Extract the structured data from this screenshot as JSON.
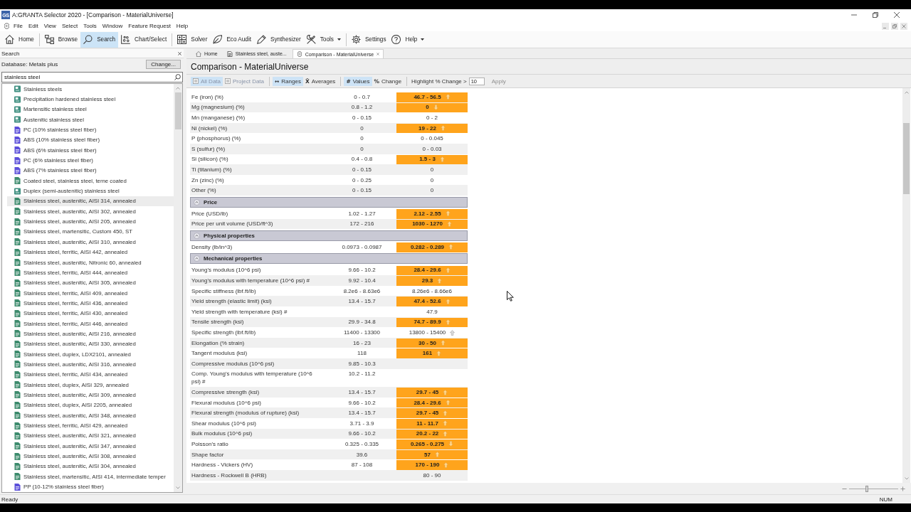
{
  "window": {
    "icon_label": "GS",
    "title": "A:GRANTA Selector 2020 - [Comparison - MaterialUniverse]"
  },
  "menu_bar": [
    "File",
    "Edit",
    "View",
    "Select",
    "Tools",
    "Window",
    "Feature Request",
    "Help"
  ],
  "toolbar": [
    [
      {
        "label": "Home",
        "kind": "home",
        "selected": false,
        "dropdown": false
      }
    ],
    [
      {
        "label": "Browse",
        "kind": "browse",
        "selected": false,
        "dropdown": false
      },
      {
        "label": "Search",
        "kind": "search",
        "selected": true,
        "dropdown": false
      },
      {
        "label": "Chart/Select",
        "kind": "chart",
        "selected": false,
        "dropdown": false
      }
    ],
    [
      {
        "label": "Solver",
        "kind": "solver",
        "selected": false,
        "dropdown": false
      },
      {
        "label": "Eco Audit",
        "kind": "eco",
        "selected": false,
        "dropdown": false
      },
      {
        "label": "Synthesizer",
        "kind": "synthesizer",
        "selected": false,
        "dropdown": false
      },
      {
        "label": "Tools",
        "kind": "tools",
        "selected": false,
        "dropdown": true
      }
    ],
    [
      {
        "label": "Settings",
        "kind": "settings",
        "selected": false,
        "dropdown": false
      },
      {
        "label": "Help",
        "kind": "help",
        "selected": false,
        "dropdown": true
      }
    ]
  ],
  "search_panel": {
    "title": "Search",
    "database": "Database: Metals plus",
    "change_button": "Change...",
    "query": "stainless steel",
    "results": [
      {
        "label": "Stainless steels",
        "kind": "group",
        "selected": false
      },
      {
        "label": "Precipitation hardened stainless steel",
        "kind": "group",
        "selected": false
      },
      {
        "label": "Martensitic stainless steel",
        "kind": "group",
        "selected": false
      },
      {
        "label": "Austenitic stainless steel",
        "kind": "group",
        "selected": false
      },
      {
        "label": "PC (10% stainless steel fiber)",
        "kind": "polymer",
        "selected": false
      },
      {
        "label": "ABS (10% stainless steel fiber)",
        "kind": "polymer",
        "selected": false
      },
      {
        "label": "ABS (6% stainless steel fiber)",
        "kind": "polymer",
        "selected": false
      },
      {
        "label": "PC (6% stainless steel fiber)",
        "kind": "polymer",
        "selected": false
      },
      {
        "label": "ABS (7% stainless steel fiber)",
        "kind": "polymer",
        "selected": false
      },
      {
        "label": "Coated steel, stainless steel, terne coated",
        "kind": "metal",
        "selected": false
      },
      {
        "label": "Duplex (semi-austenitic) stainless steel",
        "kind": "group",
        "selected": false
      },
      {
        "label": "Stainless steel, austenitic, AISI 314, annealed",
        "kind": "metal",
        "selected": true
      },
      {
        "label": "Stainless steel, austenitic, AISI 302, annealed",
        "kind": "metal",
        "selected": false
      },
      {
        "label": "Stainless steel, austenitic, AISI 205, annealed",
        "kind": "metal",
        "selected": false
      },
      {
        "label": "Stainless steel, martensitic, Custom 450, ST",
        "kind": "metal",
        "selected": false
      },
      {
        "label": "Stainless steel, austenitic, AISI 310, annealed",
        "kind": "metal",
        "selected": false
      },
      {
        "label": "Stainless steel, ferritic, AISI 442, annealed",
        "kind": "metal",
        "selected": false
      },
      {
        "label": "Stainless steel, austenitic, Nitronic 60, annealed",
        "kind": "metal",
        "selected": false
      },
      {
        "label": "Stainless steel, ferritic, AISI 444, annealed",
        "kind": "metal",
        "selected": false
      },
      {
        "label": "Stainless steel, austenitic, AISI 305, annealed",
        "kind": "metal",
        "selected": false
      },
      {
        "label": "Stainless steel, ferritic, AISI 409, annealed",
        "kind": "metal",
        "selected": false
      },
      {
        "label": "Stainless steel, ferritic, AISI 436, annealed",
        "kind": "metal",
        "selected": false
      },
      {
        "label": "Stainless steel, ferritic, AISI 430, annealed",
        "kind": "metal",
        "selected": false
      },
      {
        "label": "Stainless steel, ferritic, AISI 446, annealed",
        "kind": "metal",
        "selected": false
      },
      {
        "label": "Stainless steel, austenitic, AISI 216, annealed",
        "kind": "metal",
        "selected": false
      },
      {
        "label": "Stainless steel, austenitic, AISI 330, annealed",
        "kind": "metal",
        "selected": false
      },
      {
        "label": "Stainless steel, duplex, LDX2101, annealed",
        "kind": "metal",
        "selected": false
      },
      {
        "label": "Stainless steel, austenitic, AISI 316, annealed",
        "kind": "metal",
        "selected": false
      },
      {
        "label": "Stainless steel, ferritic, AISI 434, annealed",
        "kind": "metal",
        "selected": false
      },
      {
        "label": "Stainless steel, duplex, AISI 329, annealed",
        "kind": "metal",
        "selected": false
      },
      {
        "label": "Stainless steel, austenitic, AISI 309, annealed",
        "kind": "metal",
        "selected": false
      },
      {
        "label": "Stainless steel, duplex, AISI 2205, annealed",
        "kind": "metal",
        "selected": false
      },
      {
        "label": "Stainless steel, austenitic, AISI 348, annealed",
        "kind": "metal",
        "selected": false
      },
      {
        "label": "Stainless steel, ferritic, AISI 429, annealed",
        "kind": "metal",
        "selected": false
      },
      {
        "label": "Stainless steel, austenitic, AISI 321, annealed",
        "kind": "metal",
        "selected": false
      },
      {
        "label": "Stainless steel, austenitic, AISI 347, annealed",
        "kind": "metal",
        "selected": false
      },
      {
        "label": "Stainless steel, austenitic, AISI 308, annealed",
        "kind": "metal",
        "selected": false
      },
      {
        "label": "Stainless steel, austenitic, AISI 304, annealed",
        "kind": "metal",
        "selected": false
      },
      {
        "label": "Stainless steel, martensitic, AISI 414, intermediate temper",
        "kind": "metal",
        "selected": false
      },
      {
        "label": "PP (10-12% stainless steel fiber)",
        "kind": "polymer",
        "selected": false
      }
    ]
  },
  "document_tabs": [
    {
      "label": "Home",
      "kind": "home",
      "selected": false
    },
    {
      "label": "Stainless steel, auste...",
      "kind": "record",
      "selected": false
    },
    {
      "label": "Comparison - MaterialUniverse",
      "kind": "comparison",
      "selected": true
    }
  ],
  "comparison": {
    "title": "Comparison - MaterialUniverse",
    "toolbar": [
      [
        {
          "label": "All Data",
          "selected": true,
          "disabled": true
        },
        {
          "label": "Project Data",
          "selected": false,
          "disabled": true
        }
      ],
      [
        {
          "symbol": "↔",
          "label": "Ranges",
          "selected": true,
          "disabled": false
        },
        {
          "symbol": "X̄",
          "label": "Averages",
          "selected": false,
          "disabled": false
        }
      ],
      [
        {
          "symbol": "#",
          "label": "Values",
          "selected": true,
          "disabled": false
        },
        {
          "symbol": "%",
          "label": "Change",
          "selected": false,
          "disabled": false
        }
      ]
    ],
    "highlight": {
      "label": "Highlight % Change >",
      "value": "10",
      "apply": {
        "label": "Apply",
        "disabled": true
      }
    },
    "sections": [
      {
        "rows": [
          {
            "column_1": "Fe (iron) (%)",
            "column_2": "0 - 0.7",
            "column_3": "46.7 - 56.5",
            "highlight": true,
            "kind": "increase"
          },
          {
            "column_1": "Mg (magnesium) (%)",
            "column_2": "0.8 - 1.2",
            "column_3": "0",
            "highlight": true,
            "kind": "decrease"
          },
          {
            "column_1": "Mn (manganese) (%)",
            "column_2": "0 - 0.15",
            "column_3": "0 - 2",
            "highlight": false,
            "kind": "plain"
          },
          {
            "column_1": "Ni (nickel) (%)",
            "column_2": "0",
            "column_3": "19 - 22",
            "highlight": true,
            "kind": "increase"
          },
          {
            "column_1": "P (phosphorus) (%)",
            "column_2": "0",
            "column_3": "0 - 0.045",
            "highlight": false,
            "kind": "plain"
          },
          {
            "column_1": "S (sulfur) (%)",
            "column_2": "0",
            "column_3": "0 - 0.03",
            "highlight": false,
            "kind": "plain"
          },
          {
            "column_1": "Si (silicon) (%)",
            "column_2": "0.4 - 0.8",
            "column_3": "1.5 - 3",
            "highlight": true,
            "kind": "increase"
          },
          {
            "column_1": "Ti (titanium) (%)",
            "column_2": "0 - 0.15",
            "column_3": "0",
            "highlight": false,
            "kind": "plain"
          },
          {
            "column_1": "Zn (zinc) (%)",
            "column_2": "0 - 0.25",
            "column_3": "0",
            "highlight": false,
            "kind": "plain"
          },
          {
            "column_1": "Other (%)",
            "column_2": "0 - 0.15",
            "column_3": "0",
            "highlight": false,
            "kind": "plain"
          }
        ]
      },
      {
        "title": "Price",
        "expanded": true,
        "rows": [
          {
            "column_1": "Price (USD/lb)",
            "column_2": "1.02 - 1.27",
            "column_3": "2.12 - 2.55",
            "highlight": true,
            "kind": "increase"
          },
          {
            "column_1": "Price per unit volume (USD/ft^3)",
            "column_2": "172 - 216",
            "column_3": "1030 - 1270",
            "highlight": true,
            "kind": "increase"
          }
        ]
      },
      {
        "title": "Physical properties",
        "expanded": true,
        "rows": [
          {
            "column_1": "Density (lb/in^3)",
            "column_2": "0.0973 - 0.0987",
            "column_3": "0.282 - 0.289",
            "highlight": true,
            "kind": "increase"
          }
        ]
      },
      {
        "title": "Mechanical properties",
        "expanded": true,
        "rows": [
          {
            "column_1": "Young's modulus (10^6 psi)",
            "column_2": "9.66 - 10.2",
            "column_3": "28.4 - 29.6",
            "highlight": true,
            "kind": "increase"
          },
          {
            "column_1": "Young's modulus with temperature (10^6 psi) #",
            "column_2": "9.92 - 10.4",
            "column_3": "29.3",
            "highlight": true,
            "kind": "increase"
          },
          {
            "column_1": "Specific stiffness (lbf.ft/lb)",
            "column_2": "8.2e6 - 8.63e6",
            "column_3": "8.26e6 - 8.66e6",
            "highlight": false,
            "kind": "plain"
          },
          {
            "column_1": "Yield strength (elastic limit) (ksi)",
            "column_2": "13.4 - 15.7",
            "column_3": "47.4 - 52.6",
            "highlight": true,
            "kind": "increase"
          },
          {
            "column_1": "Yield strength with temperature (ksi) #",
            "column_3": "47.9",
            "highlight": false,
            "kind": "plain"
          },
          {
            "column_1": "Tensile strength (ksi)",
            "column_2": "29.9 - 34.8",
            "column_3": "74.7 - 89.9",
            "highlight": true,
            "kind": "increase"
          },
          {
            "column_1": "Specific strength (lbf.ft/lb)",
            "column_2": "11400 - 13300",
            "column_3": "13800 - 15400",
            "highlight": false,
            "kind": "increase"
          },
          {
            "column_1": "Elongation (% strain)",
            "column_2": "16 - 23",
            "column_3": "30 - 50",
            "highlight": true,
            "kind": "increase"
          },
          {
            "column_1": "Tangent modulus (ksi)",
            "column_2": "118",
            "column_3": "161",
            "highlight": true,
            "kind": "increase"
          },
          {
            "column_1": "Compressive modulus (10^6 psi)",
            "column_2": "9.85 - 10.3",
            "kind": "plain"
          },
          {
            "column_1": "Comp. Young's modulus with temperature (10^6 psi) #",
            "column_2": "10.2 - 11.2",
            "kind": "plain"
          },
          {
            "column_1": "Compressive strength (ksi)",
            "column_2": "13.4 - 15.7",
            "column_3": "29.7 - 45",
            "highlight": true,
            "kind": "increase"
          },
          {
            "column_1": "Flexural modulus (10^6 psi)",
            "column_2": "9.66 - 10.2",
            "column_3": "28.4 - 29.6",
            "highlight": true,
            "kind": "increase"
          },
          {
            "column_1": "Flexural strength (modulus of rupture) (ksi)",
            "column_2": "13.4 - 15.7",
            "column_3": "29.7 - 45",
            "highlight": true,
            "kind": "increase"
          },
          {
            "column_1": "Shear modulus (10^6 psi)",
            "column_2": "3.71 - 3.9",
            "column_3": "11 - 11.7",
            "highlight": true,
            "kind": "increase"
          },
          {
            "column_1": "Bulk modulus (10^6 psi)",
            "column_2": "9.66 - 10.2",
            "column_3": "20.2 - 22",
            "highlight": true,
            "kind": "increase"
          },
          {
            "column_1": "Poisson's ratio",
            "column_2": "0.325 - 0.335",
            "column_3": "0.265 - 0.275",
            "highlight": true,
            "kind": "decrease"
          },
          {
            "column_1": "Shape factor",
            "column_2": "39.6",
            "column_3": "57",
            "highlight": true,
            "kind": "increase"
          },
          {
            "column_1": "Hardness - Vickers (HV)",
            "column_2": "87 - 108",
            "column_3": "170 - 190",
            "highlight": true,
            "kind": "increase"
          },
          {
            "column_1": "Hardness - Rockwell B (HRB)",
            "column_3": "80 - 90",
            "highlight": false,
            "kind": "plain"
          }
        ]
      }
    ]
  },
  "zoom_slider": {
    "level": 0.36
  },
  "status_bar": {
    "text": "Ready",
    "indicator": "NUM"
  }
}
